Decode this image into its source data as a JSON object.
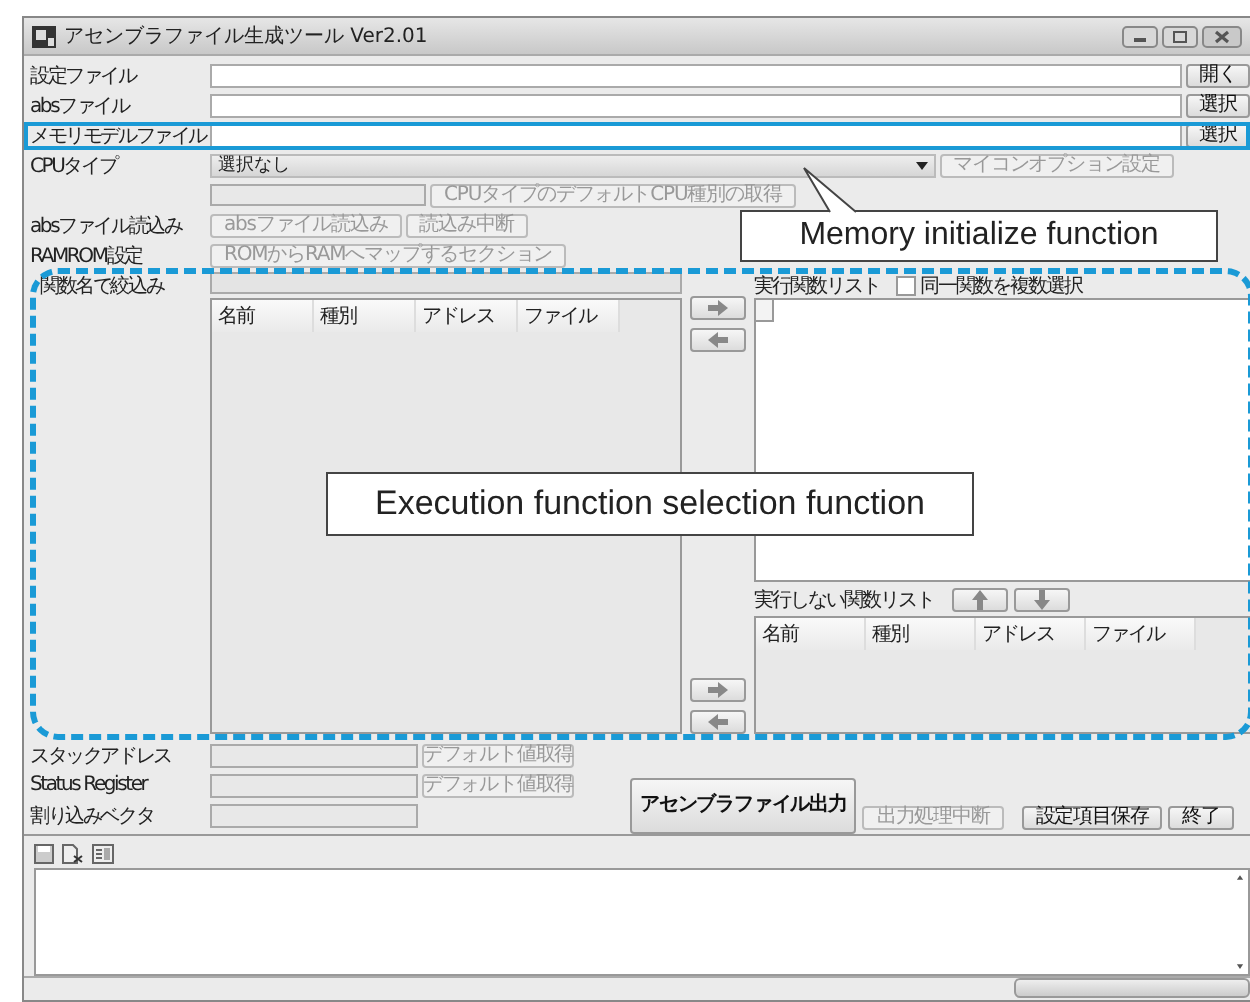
{
  "window": {
    "title": "アセンブラファイル生成ツール  Ver2.01"
  },
  "file_rows": [
    {
      "label": "設定ファイル",
      "button": "開く",
      "highlighted": false
    },
    {
      "label": "absファイル",
      "button": "選択",
      "highlighted": false
    },
    {
      "label": "メモリモデルファイル",
      "button": "選択",
      "highlighted": true
    }
  ],
  "cpu": {
    "label": "CPUタイプ",
    "value": "選択なし",
    "option_button": {
      "label": "マイコンオプション設定",
      "disabled": true
    },
    "default_button": {
      "label": "CPUタイプのデフォルトCPU種別の取得",
      "disabled": true
    }
  },
  "abs_load": {
    "label": "absファイル読込み",
    "buttons": [
      {
        "label": "absファイル読込み",
        "disabled": true
      },
      {
        "label": "読込み中断",
        "disabled": true
      }
    ]
  },
  "ramrom": {
    "label": "RAMROM設定",
    "button": {
      "label": "ROMからRAMへマップするセクション",
      "disabled": true
    }
  },
  "filter": {
    "label": "関数名で絞込み"
  },
  "function_table": {
    "columns": [
      "名前",
      "種別",
      "アドレス",
      "ファイル"
    ]
  },
  "exec_list": {
    "label": "実行関数リスト",
    "checkbox": {
      "label": "同一関数を複数選択",
      "checked": false
    }
  },
  "non_exec_list": {
    "label": "実行しない関数リスト",
    "columns": [
      "名前",
      "種別",
      "アドレス",
      "ファイル"
    ]
  },
  "registers": [
    {
      "label": "スタックアドレス",
      "button": {
        "label": "デフォルト値取得",
        "disabled": true
      }
    },
    {
      "label": "Status Register",
      "button": {
        "label": "デフォルト値取得",
        "disabled": true
      }
    },
    {
      "label": "割り込みベクタ"
    }
  ],
  "actions": [
    {
      "label": "アセンブラファイル出力",
      "kind": "primary",
      "disabled": false
    },
    {
      "label": "出力処理中断",
      "kind": "small",
      "disabled": true
    },
    {
      "label": "設定項目保存",
      "kind": "small",
      "disabled": false
    },
    {
      "label": "終了",
      "kind": "small",
      "disabled": false
    }
  ],
  "annotations": [
    {
      "text": "Memory initialize function",
      "kind": "pointer"
    },
    {
      "text": "Execution function selection function",
      "kind": "region"
    }
  ]
}
